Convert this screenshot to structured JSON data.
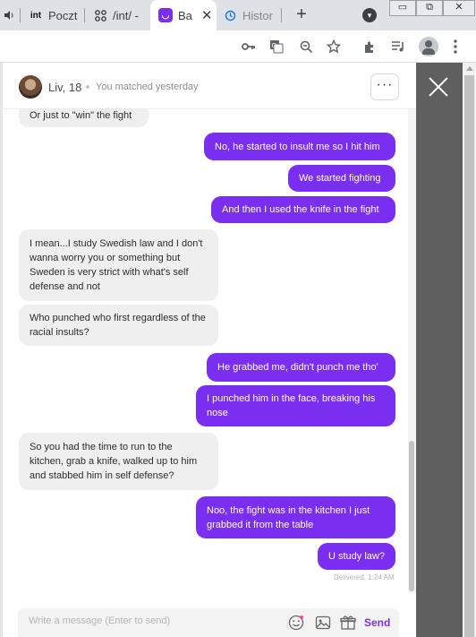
{
  "browser": {
    "tabs": [
      {
        "title": "",
        "icon": "speaker-icon"
      },
      {
        "title": "Poczt",
        "icon": "int"
      },
      {
        "title": "/int/ -",
        "icon": "grid-icon"
      },
      {
        "title": "Ba",
        "icon": "badoo-icon",
        "active": true
      },
      {
        "title": "Histor",
        "icon": "history-icon"
      }
    ],
    "close_glyph": "✕",
    "new_tab_glyph": "+",
    "window_buttons": [
      "▭",
      "⧉",
      "✕"
    ],
    "toolbar_icons": [
      "key-icon",
      "translate-icon",
      "zoom-icon",
      "star-icon",
      "extensions-icon",
      "media-icon",
      "profile-icon",
      "menu-icon"
    ]
  },
  "chat": {
    "profile_name": "Liv, 18",
    "match_text": "You matched yesterday",
    "more_label": "···",
    "messages": [
      {
        "dir": "in",
        "text": "Or just to \"win\" the fight"
      },
      {
        "dir": "out",
        "text": "No, he started to insult me so I hit him"
      },
      {
        "dir": "out",
        "text": "We started fighting"
      },
      {
        "dir": "out",
        "text": "And then I used the knife in the fight"
      },
      {
        "dir": "in",
        "text": "I mean...I study Swedish law and I don't wanna worry you or something but Sweden is very strict with what's self defense and not"
      },
      {
        "dir": "in",
        "text": "Who punched who first regardless of the racial insults?"
      },
      {
        "dir": "out",
        "text": "He grabbed me, didn't punch me tho'"
      },
      {
        "dir": "out",
        "text": "I punched him in the face, breaking his nose"
      },
      {
        "dir": "in",
        "text": "So you had the time to run to the kitchen, grab a knife, walked up to him and stabbed him in self defense?"
      },
      {
        "dir": "out",
        "text": "Noo, the fight was in the kitchen I just grabbed it from the table"
      },
      {
        "dir": "out",
        "text": "U study law?"
      }
    ],
    "delivered": "Delivered, 1:24 AM",
    "composer": {
      "placeholder": "Write a message (Enter to send)",
      "send_label": "Send"
    }
  },
  "colors": {
    "accent": "#7a2ff0",
    "incoming_bubble": "#efefef",
    "overlay": "#5f5f5f"
  }
}
